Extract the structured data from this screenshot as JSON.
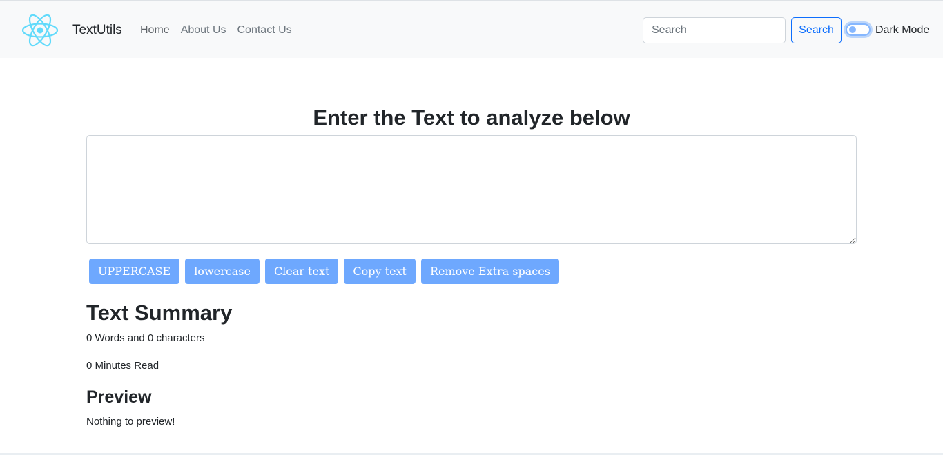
{
  "navbar": {
    "logo_icon": "react-atom-icon",
    "logo_color": "#61dafb",
    "brand": "TextUtils",
    "links": [
      {
        "label": "Home"
      },
      {
        "label": "About Us"
      },
      {
        "label": "Contact Us"
      }
    ],
    "search": {
      "placeholder": "Search",
      "value": "",
      "button_label": "Search"
    },
    "dark_mode": {
      "label": "Dark Mode",
      "enabled": false
    }
  },
  "main": {
    "heading": "Enter the Text to analyze below",
    "textarea": {
      "value": ""
    },
    "buttons": [
      {
        "label": "UPPERCASE"
      },
      {
        "label": "lowercase"
      },
      {
        "label": "Clear text"
      },
      {
        "label": "Copy text"
      },
      {
        "label": "Remove Extra spaces"
      }
    ],
    "summary": {
      "title": "Text Summary",
      "counts": "0 Words and 0 characters",
      "read_time": "0 Minutes Read"
    },
    "preview": {
      "title": "Preview",
      "text": "Nothing to preview!"
    }
  },
  "colors": {
    "accent": "#0d6efd",
    "button_bg": "#6ea8fe",
    "navbar_bg": "#f8f9fa"
  }
}
